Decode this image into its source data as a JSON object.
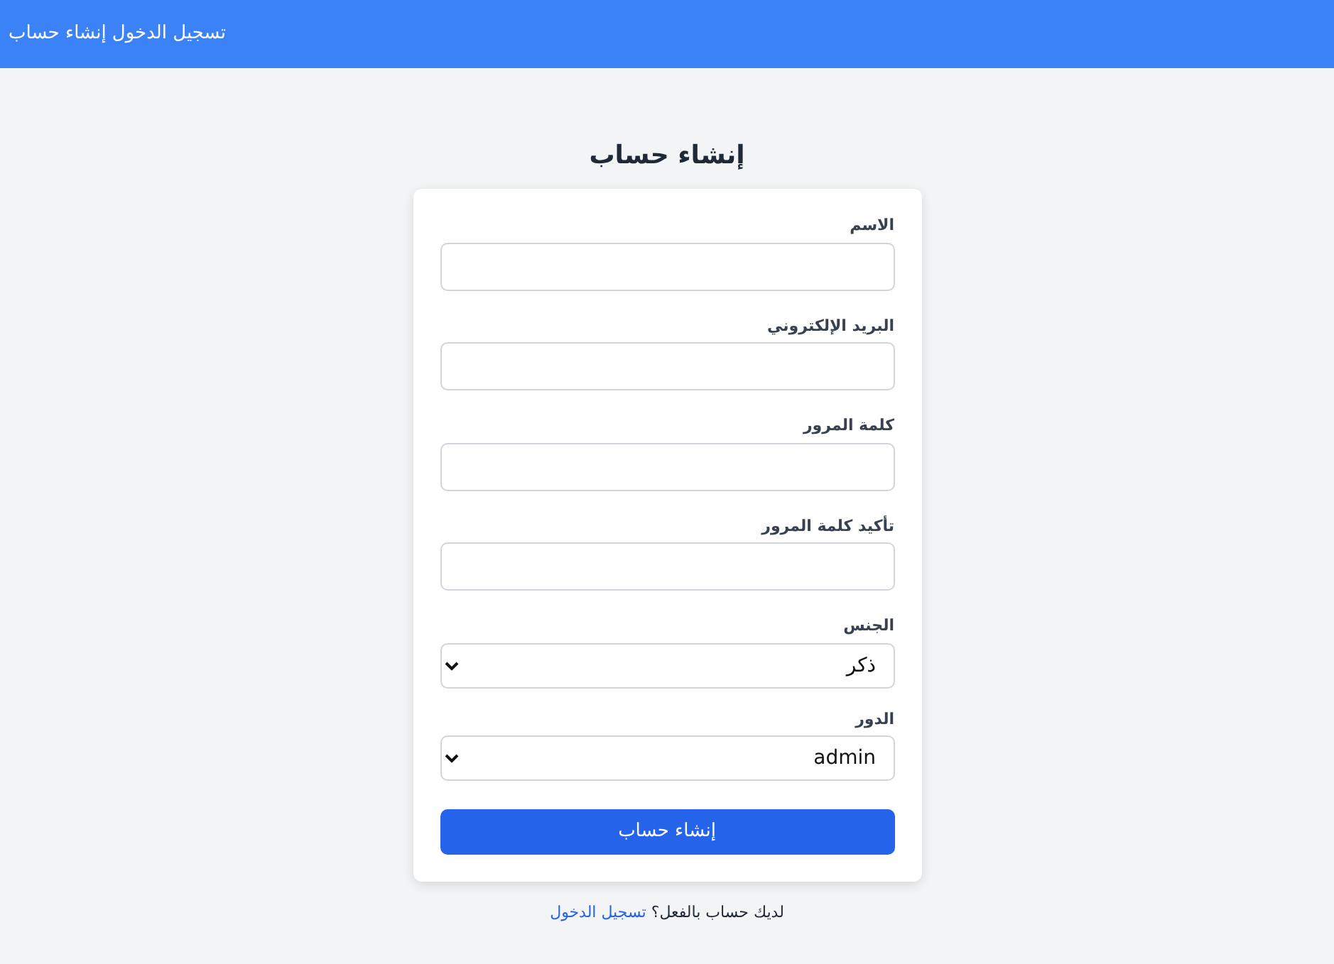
{
  "navbar": {
    "links": [
      {
        "label": "تسجيل الدخول"
      },
      {
        "label": "إنشاء حساب"
      }
    ]
  },
  "title": "إنشاء حساب",
  "fields": [
    {
      "kind": "input",
      "label": "الاسم"
    },
    {
      "kind": "input",
      "label": "البريد الإلكتروني"
    },
    {
      "kind": "input",
      "label": "كلمة المرور"
    },
    {
      "kind": "input",
      "label": "تأكيد كلمة المرور"
    },
    {
      "kind": "select",
      "label": "الجنس",
      "value": "ذكر"
    },
    {
      "kind": "select",
      "label": "الدور",
      "value": "admin"
    }
  ],
  "submit_button": "إنشاء حساب",
  "footer": {
    "text": "لديك حساب بالفعل؟",
    "link": "تسجيل الدخول"
  }
}
